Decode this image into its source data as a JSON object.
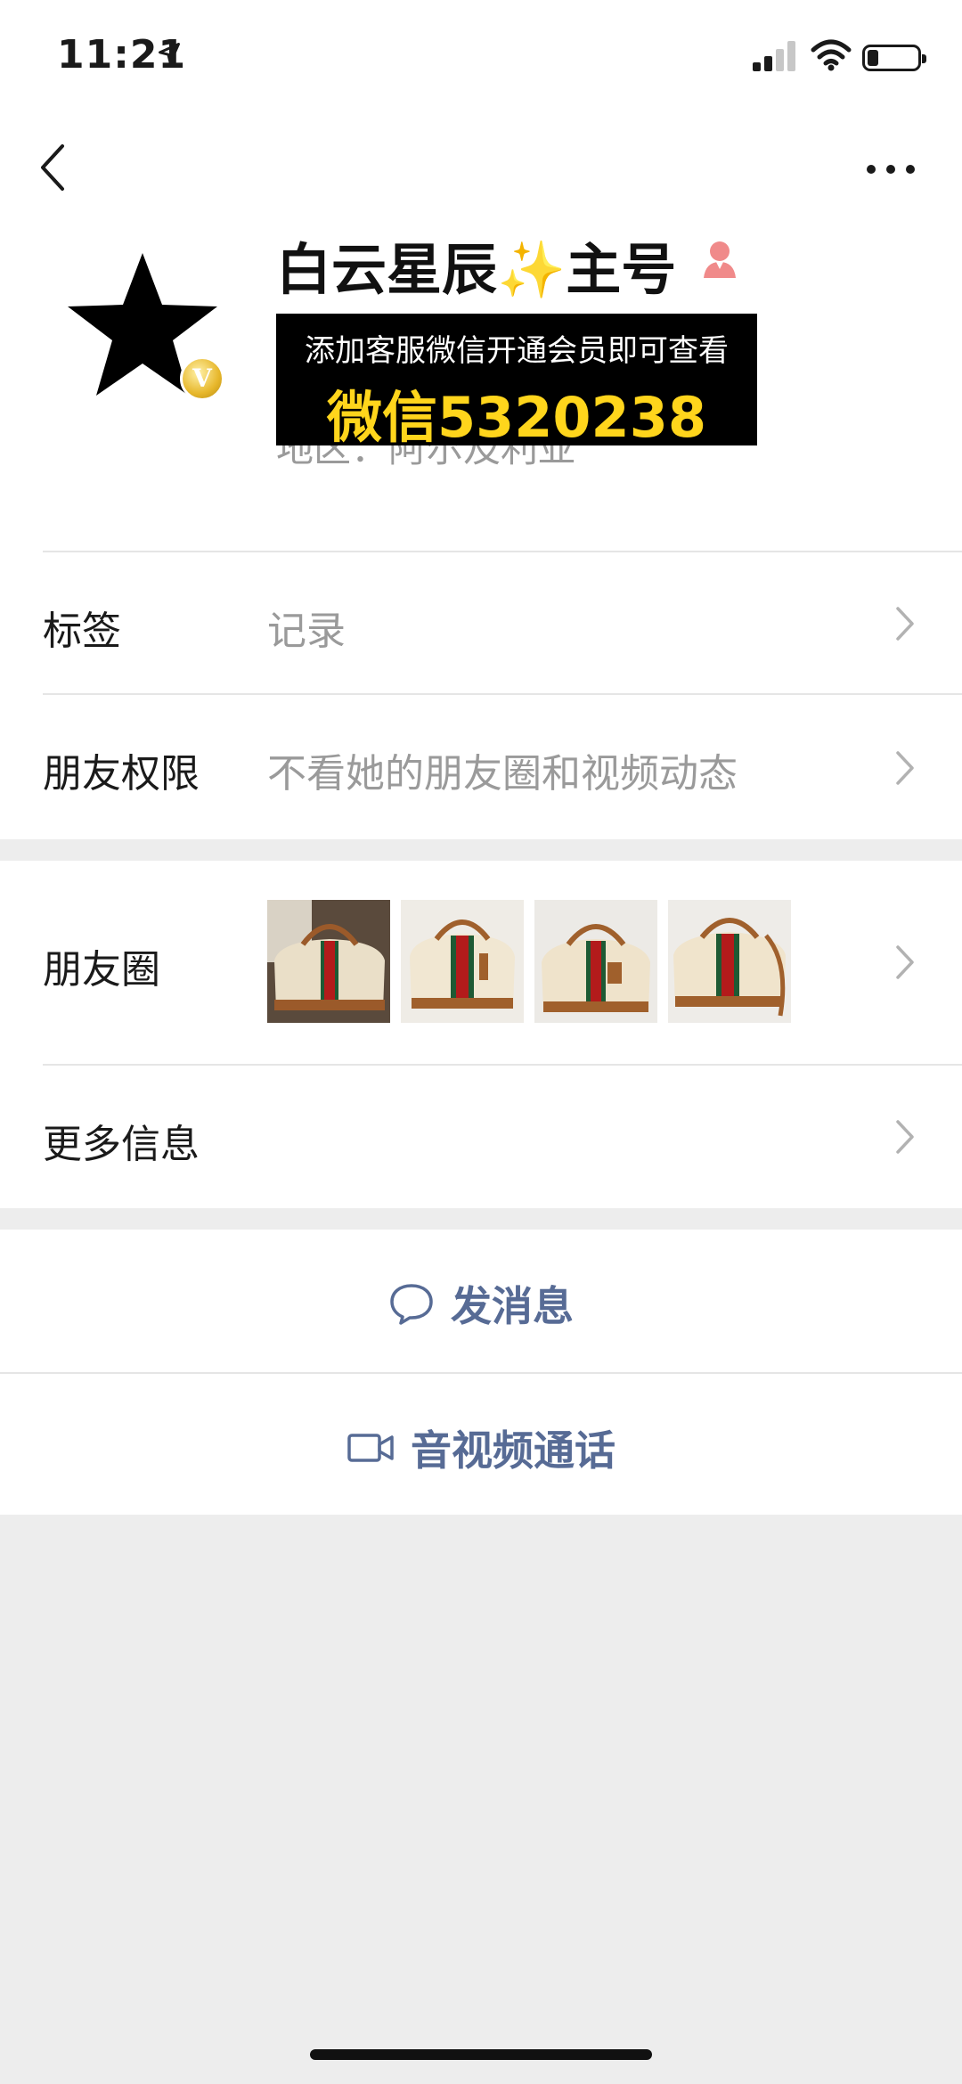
{
  "status_bar": {
    "time": "11:21",
    "icons": [
      "location-arrow-icon",
      "signal-icon",
      "wifi-icon",
      "battery-icon"
    ]
  },
  "nav": {
    "back_icon": "chevron-left-icon",
    "more_icon": "more-dots-icon"
  },
  "profile": {
    "name": "白云星辰",
    "name_emoji": "✨",
    "name_suffix": "主号",
    "gender_icon": "female-person-icon",
    "region": "地区：阿尔及利亚",
    "verified_badge": "V"
  },
  "overlay_ad": {
    "line1": "添加客服微信开通会员即可查看",
    "line2": "微信5320238",
    "line2_color": "#ffd51c"
  },
  "rows": {
    "tags": {
      "label": "标签",
      "value": "记录"
    },
    "permissions": {
      "label": "朋友权限",
      "value": "不看她的朋友圈和视频动态"
    },
    "moments": {
      "label": "朋友圈"
    },
    "more_info": {
      "label": "更多信息"
    }
  },
  "actions": {
    "message": {
      "label": "发消息",
      "icon": "chat-bubble-icon"
    },
    "call": {
      "label": "音视频通话",
      "icon": "video-camera-icon"
    }
  },
  "colors": {
    "link_blue": "#576b95",
    "background": "#ededed"
  }
}
